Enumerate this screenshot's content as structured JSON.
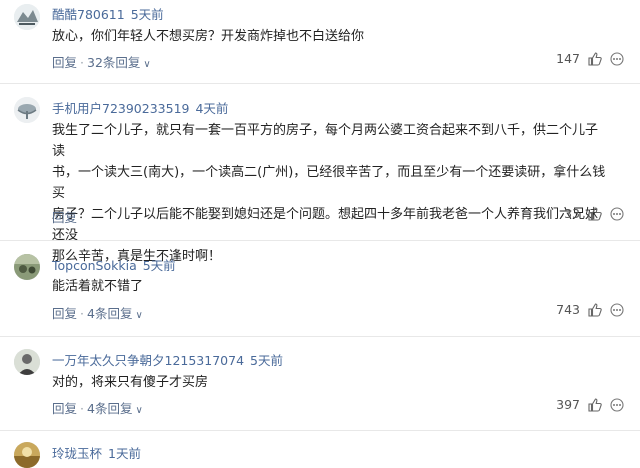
{
  "comments": [
    {
      "username": "酷酷780611",
      "time": "5天前",
      "text": "放心，你们年轻人不想买房？开发商炸掉也不白送给你",
      "reply_label": "回复",
      "replies_label": "32条回复",
      "likes": "147"
    },
    {
      "username": "手机用户72390233519",
      "time": "4天前",
      "text_lines": [
        "我生了二个儿子，就只有一套一百平方的房子，每个月两公婆工资合起来不到八千，供二个儿子读",
        "书，一个读大三(南大)，一个读高二(广州)，已经很辛苦了，而且至少有一个还要读研，拿什么钱买",
        "房子？二个儿子以后能不能娶到媳妇还是个问题。想起四十多年前我老爸一个人养育我们六兄妹还没",
        "那么辛苦，真是生不逢时啊！"
      ],
      "reply_label": "回复",
      "likes": "33"
    },
    {
      "username": "TopconSokkia",
      "time": "5天前",
      "text": "能活着就不错了",
      "reply_label": "回复",
      "replies_label": "4条回复",
      "likes": "743"
    },
    {
      "username": "一万年太久只争朝夕1215317074",
      "time": "5天前",
      "text": "对的，将来只有傻子才买房",
      "reply_label": "回复",
      "replies_label": "4条回复",
      "likes": "397"
    },
    {
      "username": "玲珑玉杯",
      "time": "1天前"
    }
  ],
  "icons": {
    "like": "thumbs-up-icon",
    "more": "more-options-icon",
    "expand": "chevron-down-icon"
  }
}
